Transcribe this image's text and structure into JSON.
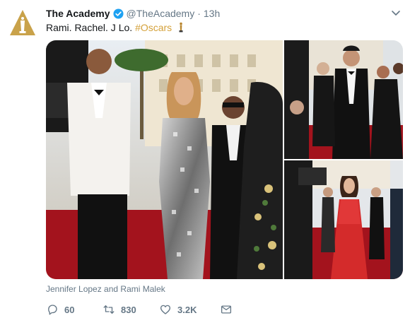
{
  "tweet": {
    "display_name": "The Academy",
    "handle": "@TheAcademy",
    "separator": "·",
    "time": "13h",
    "text_main": "Rami. Rachel. J Lo. ",
    "hashtag": "#Oscars",
    "media_caption": "Jennifer Lopez and Rami Malek",
    "reply_count": "60",
    "retweet_count": "830",
    "like_count": "3.2K"
  },
  "icons": {
    "avatar": "oscar-statuette-logo",
    "verified": "verified-badge-icon",
    "caret": "chevron-down-icon",
    "hashtag_emoji": "oscar-trophy-icon",
    "reply": "reply-icon",
    "retweet": "retweet-icon",
    "like": "heart-icon",
    "dm": "envelope-icon"
  },
  "colors": {
    "name": "#14171a",
    "meta": "#657786",
    "hashtag": "#d4a13a",
    "verified": "#1da1f2",
    "logo_gold": "#c9a24a"
  }
}
